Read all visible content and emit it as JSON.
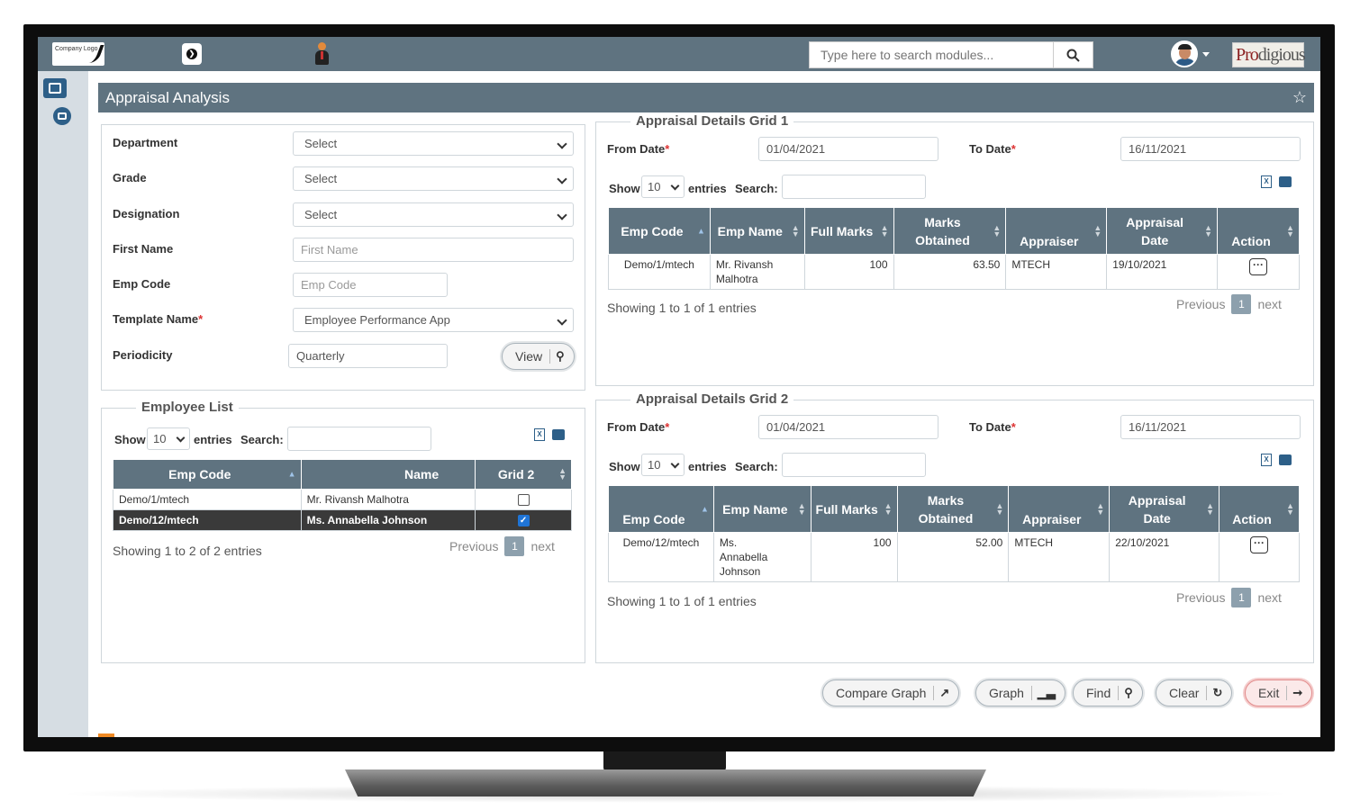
{
  "topbar": {
    "company_logo_text": "Company Logo",
    "search_placeholder": "Type here to search modules...",
    "brand_logo": "Prodigious",
    "brand_logo_first": "Pro",
    "brand_logo_rest": "digious"
  },
  "header": {
    "title": "Appraisal Analysis"
  },
  "filters": {
    "department_label": "Department",
    "department_value": "Select",
    "grade_label": "Grade",
    "grade_value": "Select",
    "designation_label": "Designation",
    "designation_value": "Select",
    "first_name_label": "First Name",
    "first_name_placeholder": "First Name",
    "emp_code_label": "Emp Code",
    "emp_code_placeholder": "Emp Code",
    "template_label": "Template Name",
    "template_value": "Employee Performance App",
    "periodicity_label": "Periodicity",
    "periodicity_value": "Quarterly",
    "view_button": "View"
  },
  "employee_list": {
    "legend": "Employee List",
    "show_label": "Show",
    "entries_value": "10",
    "entries_label": "entries",
    "search_label": "Search:",
    "columns": [
      "Emp Code",
      "Name",
      "Grid 2"
    ],
    "rows": [
      {
        "code": "Demo/1/mtech",
        "name": "Mr. Rivansh Malhotra",
        "checked": false
      },
      {
        "code": "Demo/12/mtech",
        "name": "Ms. Annabella Johnson",
        "checked": true
      }
    ],
    "showing": "Showing 1 to 2 of 2 entries",
    "previous": "Previous",
    "page": "1",
    "next": "next"
  },
  "grid1": {
    "legend": "Appraisal Details Grid 1",
    "from_label": "From Date",
    "from_value": "01/04/2021",
    "to_label": "To Date",
    "to_value": "16/11/2021",
    "show_label": "Show",
    "entries_value": "10",
    "entries_label": "entries",
    "search_label": "Search:",
    "col_emp_code": "Emp Code",
    "col_emp_name": "Emp Name",
    "col_full_marks": "Full Marks",
    "col_marks_obtained": "Marks Obtained",
    "col_appraiser": "Appraiser",
    "col_appraisal_date": "Appraisal Date",
    "col_action": "Action",
    "row": {
      "code": "Demo/1/mtech",
      "name": "Mr. Rivansh Malhotra",
      "full": "100",
      "obtained": "63.50",
      "appraiser": "MTECH",
      "date": "19/10/2021"
    },
    "showing": "Showing 1 to 1 of 1 entries",
    "previous": "Previous",
    "page": "1",
    "next": "next"
  },
  "grid2": {
    "legend": "Appraisal Details Grid 2",
    "from_label": "From Date",
    "from_value": "01/04/2021",
    "to_label": "To Date",
    "to_value": "16/11/2021",
    "show_label": "Show",
    "entries_value": "10",
    "entries_label": "entries",
    "search_label": "Search:",
    "col_emp_code": "Emp Code",
    "col_emp_name": "Emp Name",
    "col_full_marks": "Full Marks",
    "col_marks_obtained": "Marks Obtained",
    "col_appraiser": "Appraiser",
    "col_appraisal_date": "Appraisal Date",
    "col_action": "Action",
    "row": {
      "code": "Demo/12/mtech",
      "name": "Ms. Annabella Johnson",
      "full": "100",
      "obtained": "52.00",
      "appraiser": "MTECH",
      "date": "22/10/2021"
    },
    "showing": "Showing 1 to 1 of 1 entries",
    "previous": "Previous",
    "page": "1",
    "next": "next"
  },
  "actions": {
    "compare_graph": "Compare Graph",
    "graph": "Graph",
    "find": "Find",
    "clear": "Clear",
    "exit": "Exit"
  }
}
